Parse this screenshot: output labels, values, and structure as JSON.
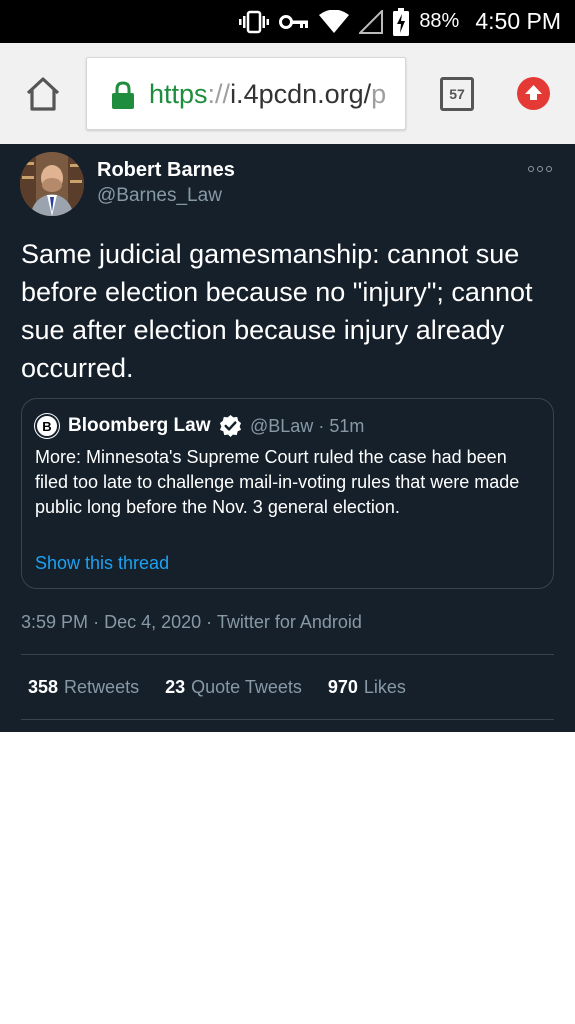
{
  "status_bar": {
    "icons": [
      "vibrate-icon",
      "vpn-key-icon",
      "wifi-icon",
      "signal-icon",
      "battery-charging-icon"
    ],
    "battery": "88%",
    "time": "4:50 PM"
  },
  "browser": {
    "url_scheme": "https",
    "url_separator": "://",
    "url_host": "i.4pcdn.org/",
    "url_tail": "p",
    "tab_count": "57",
    "icons": [
      "home-icon",
      "lock-icon",
      "tabs-icon",
      "update-icon"
    ],
    "colors": {
      "lock": "#1e8e3e",
      "update": "#e53935",
      "toolbar": "#f1f1f1"
    }
  },
  "tweet": {
    "author": {
      "name": "Robert Barnes",
      "handle": "@Barnes_Law"
    },
    "text": "Same judicial gamesmanship: cannot sue before election because no \"injury\"; cannot sue after election because injury already occurred.",
    "quote": {
      "avatar_letter": "B",
      "name": "Bloomberg Law",
      "handle": "@BLaw",
      "dot": "·",
      "age": "51m",
      "text": "More: Minnesota's Supreme Court ruled the case had been filed too late to challenge mail-in-voting rules that were made public long before the Nov. 3 general election.",
      "show_thread": "Show this thread"
    },
    "meta": {
      "time": "3:59 PM",
      "date": "Dec 4, 2020",
      "source": "Twitter for Android",
      "separator": "·"
    },
    "stats": [
      {
        "count": "358",
        "label": "Retweets"
      },
      {
        "count": "23",
        "label": "Quote Tweets"
      },
      {
        "count": "970",
        "label": "Likes"
      }
    ],
    "colors": {
      "background": "#15202b",
      "secondary_text": "#8899a6",
      "link": "#1da1f2",
      "border": "#38444d"
    }
  }
}
